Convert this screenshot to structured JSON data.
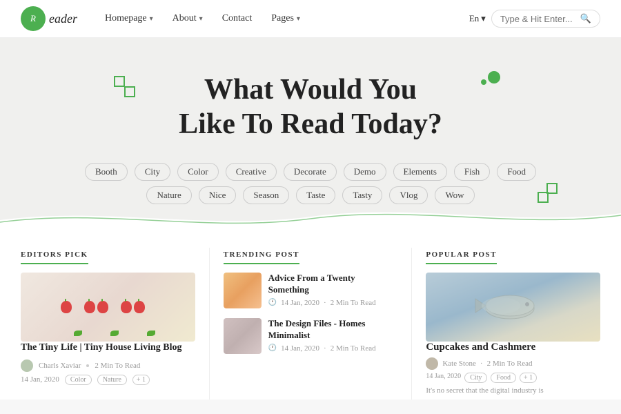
{
  "header": {
    "logo_letter": "Reader",
    "nav": [
      {
        "label": "Homepage",
        "has_arrow": true
      },
      {
        "label": "About",
        "has_arrow": true
      },
      {
        "label": "Contact",
        "has_arrow": false
      },
      {
        "label": "Pages",
        "has_arrow": true
      }
    ],
    "lang": "En",
    "search_placeholder": "Type & Hit Enter..."
  },
  "hero": {
    "title_line1": "What Would You",
    "title_line2": "Like To Read Today?",
    "tags": [
      "Booth",
      "City",
      "Color",
      "Creative",
      "Decorate",
      "Demo",
      "Elements",
      "Fish",
      "Food",
      "Nature",
      "Nice",
      "Season",
      "Taste",
      "Tasty",
      "Vlog",
      "Wow"
    ]
  },
  "editors_pick": {
    "section_label": "EDITORS PICK",
    "article_title": "The Tiny Life | Tiny House Living Blog",
    "author": "Charls Xaviar",
    "read_time": "2 Min To Read",
    "date": "14 Jan, 2020",
    "tag1": "Color",
    "tag2": "Nature",
    "extra": "+ 1"
  },
  "trending_post": {
    "section_label": "TRENDING POST",
    "items": [
      {
        "title": "Advice From a Twenty Something",
        "date": "14 Jan, 2020",
        "read_time": "2 Min To Read"
      },
      {
        "title": "The Design Files - Homes Minimalist",
        "date": "14 Jan, 2020",
        "read_time": "2 Min To Read"
      }
    ]
  },
  "popular_post": {
    "section_label": "POPULAR POST",
    "title": "Cupcakes and Cashmere",
    "author": "Kate Stone",
    "read_time": "2 Min To Read",
    "date": "14 Jan, 2020",
    "tag1": "City",
    "tag2": "Food",
    "extra": "+ 1",
    "desc": "It's no secret that the digital industry is"
  }
}
